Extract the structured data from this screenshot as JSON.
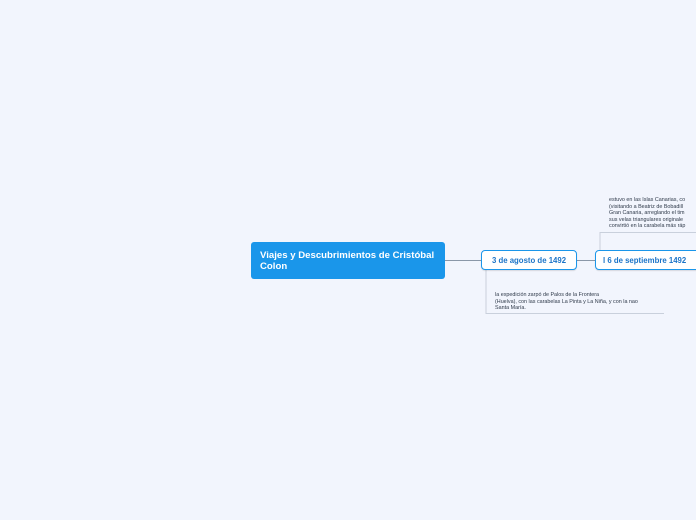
{
  "diagram": {
    "root": {
      "label": "Viajes y Descubrimientos de Cristóbal Colon"
    },
    "topics": [
      {
        "label": "3 de agosto de 1492"
      },
      {
        "label": "l 6 de septiembre 1492"
      }
    ],
    "notes": [
      {
        "lines": [
          "la expedición zarpó de Palos de la Frontera",
          "(Huelva), con las carabelas La Pinta y La Niña, y con la nao",
          "Santa María."
        ]
      },
      {
        "lines": [
          "estuvo en las Islas Canarias, co",
          "(visitando a Beatriz de Bobadill",
          "Gran Canaria, arreglando el tim",
          "sus velas triangulares originale",
          "convirtió en la carabela más ráp"
        ]
      }
    ]
  },
  "colors": {
    "background": "#f2f5fd",
    "root_fill": "#1a96ea",
    "topic_border": "#1a96ea",
    "topic_text": "#1b74c8",
    "connector": "#8a97a8",
    "note_underline": "#c9d0dc"
  }
}
